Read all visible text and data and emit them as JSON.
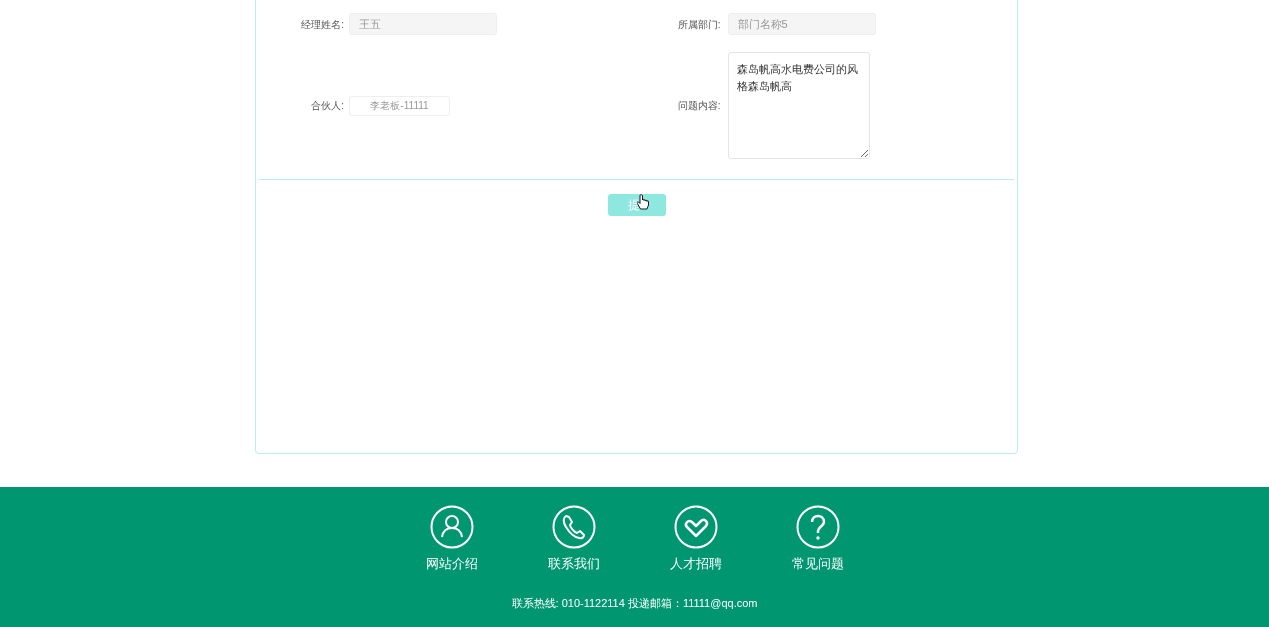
{
  "form": {
    "rows": [
      [
        {
          "label": "经理姓名:",
          "kind": "input",
          "value": "王五",
          "disabled": true
        },
        {
          "label": "所属部门:",
          "kind": "input",
          "value": "部门名称5",
          "disabled": true
        }
      ],
      [
        {
          "label": "合伙人:",
          "kind": "small_input",
          "placeholder": "李老板-11111"
        },
        {
          "label": "问题内容:",
          "kind": "textarea",
          "value": "森岛帆高水电费公司的风格森岛帆高",
          "disabled": false
        }
      ]
    ],
    "submit": "提"
  },
  "footer": {
    "links": [
      {
        "label": "网站介绍",
        "kind": "person"
      },
      {
        "label": "联系我们",
        "kind": "phone"
      },
      {
        "label": "人才招聘",
        "kind": "heart"
      },
      {
        "label": "常见问题",
        "kind": "question"
      }
    ],
    "contact": "联系热线: 010-1122114 投递邮箱：11111@qq.com"
  }
}
